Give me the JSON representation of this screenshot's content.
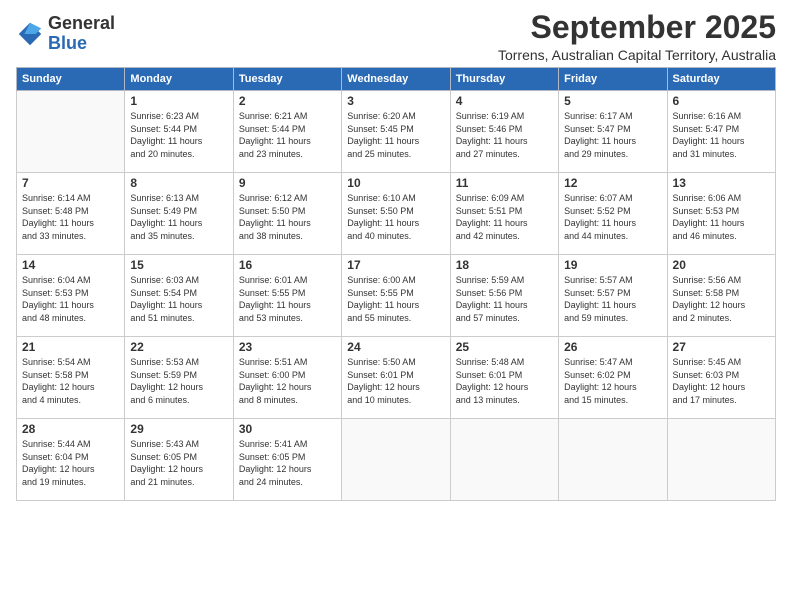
{
  "logo": {
    "general": "General",
    "blue": "Blue"
  },
  "title": "September 2025",
  "location": "Torrens, Australian Capital Territory, Australia",
  "headers": [
    "Sunday",
    "Monday",
    "Tuesday",
    "Wednesday",
    "Thursday",
    "Friday",
    "Saturday"
  ],
  "weeks": [
    [
      {
        "num": "",
        "info": ""
      },
      {
        "num": "1",
        "info": "Sunrise: 6:23 AM\nSunset: 5:44 PM\nDaylight: 11 hours\nand 20 minutes."
      },
      {
        "num": "2",
        "info": "Sunrise: 6:21 AM\nSunset: 5:44 PM\nDaylight: 11 hours\nand 23 minutes."
      },
      {
        "num": "3",
        "info": "Sunrise: 6:20 AM\nSunset: 5:45 PM\nDaylight: 11 hours\nand 25 minutes."
      },
      {
        "num": "4",
        "info": "Sunrise: 6:19 AM\nSunset: 5:46 PM\nDaylight: 11 hours\nand 27 minutes."
      },
      {
        "num": "5",
        "info": "Sunrise: 6:17 AM\nSunset: 5:47 PM\nDaylight: 11 hours\nand 29 minutes."
      },
      {
        "num": "6",
        "info": "Sunrise: 6:16 AM\nSunset: 5:47 PM\nDaylight: 11 hours\nand 31 minutes."
      }
    ],
    [
      {
        "num": "7",
        "info": "Sunrise: 6:14 AM\nSunset: 5:48 PM\nDaylight: 11 hours\nand 33 minutes."
      },
      {
        "num": "8",
        "info": "Sunrise: 6:13 AM\nSunset: 5:49 PM\nDaylight: 11 hours\nand 35 minutes."
      },
      {
        "num": "9",
        "info": "Sunrise: 6:12 AM\nSunset: 5:50 PM\nDaylight: 11 hours\nand 38 minutes."
      },
      {
        "num": "10",
        "info": "Sunrise: 6:10 AM\nSunset: 5:50 PM\nDaylight: 11 hours\nand 40 minutes."
      },
      {
        "num": "11",
        "info": "Sunrise: 6:09 AM\nSunset: 5:51 PM\nDaylight: 11 hours\nand 42 minutes."
      },
      {
        "num": "12",
        "info": "Sunrise: 6:07 AM\nSunset: 5:52 PM\nDaylight: 11 hours\nand 44 minutes."
      },
      {
        "num": "13",
        "info": "Sunrise: 6:06 AM\nSunset: 5:53 PM\nDaylight: 11 hours\nand 46 minutes."
      }
    ],
    [
      {
        "num": "14",
        "info": "Sunrise: 6:04 AM\nSunset: 5:53 PM\nDaylight: 11 hours\nand 48 minutes."
      },
      {
        "num": "15",
        "info": "Sunrise: 6:03 AM\nSunset: 5:54 PM\nDaylight: 11 hours\nand 51 minutes."
      },
      {
        "num": "16",
        "info": "Sunrise: 6:01 AM\nSunset: 5:55 PM\nDaylight: 11 hours\nand 53 minutes."
      },
      {
        "num": "17",
        "info": "Sunrise: 6:00 AM\nSunset: 5:55 PM\nDaylight: 11 hours\nand 55 minutes."
      },
      {
        "num": "18",
        "info": "Sunrise: 5:59 AM\nSunset: 5:56 PM\nDaylight: 11 hours\nand 57 minutes."
      },
      {
        "num": "19",
        "info": "Sunrise: 5:57 AM\nSunset: 5:57 PM\nDaylight: 11 hours\nand 59 minutes."
      },
      {
        "num": "20",
        "info": "Sunrise: 5:56 AM\nSunset: 5:58 PM\nDaylight: 12 hours\nand 2 minutes."
      }
    ],
    [
      {
        "num": "21",
        "info": "Sunrise: 5:54 AM\nSunset: 5:58 PM\nDaylight: 12 hours\nand 4 minutes."
      },
      {
        "num": "22",
        "info": "Sunrise: 5:53 AM\nSunset: 5:59 PM\nDaylight: 12 hours\nand 6 minutes."
      },
      {
        "num": "23",
        "info": "Sunrise: 5:51 AM\nSunset: 6:00 PM\nDaylight: 12 hours\nand 8 minutes."
      },
      {
        "num": "24",
        "info": "Sunrise: 5:50 AM\nSunset: 6:01 PM\nDaylight: 12 hours\nand 10 minutes."
      },
      {
        "num": "25",
        "info": "Sunrise: 5:48 AM\nSunset: 6:01 PM\nDaylight: 12 hours\nand 13 minutes."
      },
      {
        "num": "26",
        "info": "Sunrise: 5:47 AM\nSunset: 6:02 PM\nDaylight: 12 hours\nand 15 minutes."
      },
      {
        "num": "27",
        "info": "Sunrise: 5:45 AM\nSunset: 6:03 PM\nDaylight: 12 hours\nand 17 minutes."
      }
    ],
    [
      {
        "num": "28",
        "info": "Sunrise: 5:44 AM\nSunset: 6:04 PM\nDaylight: 12 hours\nand 19 minutes."
      },
      {
        "num": "29",
        "info": "Sunrise: 5:43 AM\nSunset: 6:05 PM\nDaylight: 12 hours\nand 21 minutes."
      },
      {
        "num": "30",
        "info": "Sunrise: 5:41 AM\nSunset: 6:05 PM\nDaylight: 12 hours\nand 24 minutes."
      },
      {
        "num": "",
        "info": ""
      },
      {
        "num": "",
        "info": ""
      },
      {
        "num": "",
        "info": ""
      },
      {
        "num": "",
        "info": ""
      }
    ]
  ]
}
